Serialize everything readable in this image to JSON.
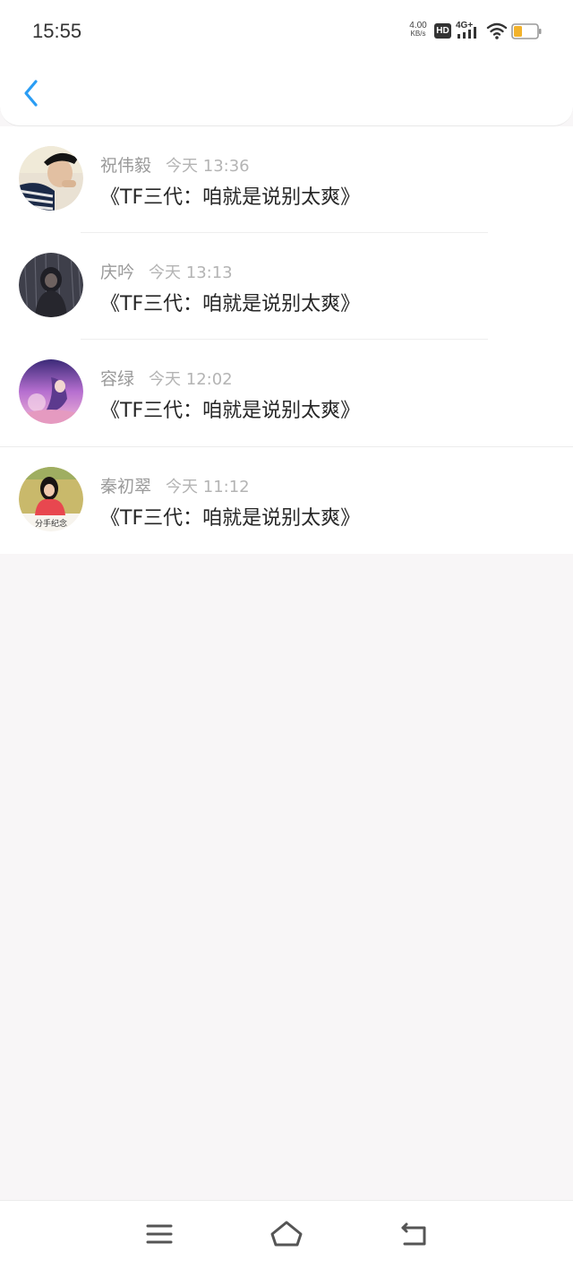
{
  "status_bar": {
    "time": "15:55",
    "net_speed_value": "4.00",
    "net_speed_unit": "KB/s",
    "hd_badge": "HD",
    "network_type": "4G+"
  },
  "header": {
    "back_icon": "chevron-left-icon",
    "accent_color": "#2a9df4"
  },
  "comments": [
    {
      "avatar": "avatar-man-striped-shirt",
      "name": "祝伟毅",
      "time": "今天 13:36",
      "text": "《TF三代：咱就是说别太爽》"
    },
    {
      "avatar": "avatar-dark-rain-girl",
      "name": "庆吟",
      "time": "今天 13:13",
      "text": "《TF三代：咱就是说别太爽》"
    },
    {
      "avatar": "avatar-anime-purple-sky",
      "name": "容绿",
      "time": "今天 12:02",
      "text": "《TF三代：咱就是说别太爽》"
    },
    {
      "avatar": "avatar-girl-red-dress",
      "avatar_caption": "分手纪念",
      "name": "秦初翠",
      "time": "今天 11:12",
      "text": "《TF三代：咱就是说别太爽》"
    }
  ],
  "nav_bar": {
    "menu_icon": "menu-icon",
    "home_icon": "home-icon",
    "back_icon": "back-arrow-icon"
  }
}
